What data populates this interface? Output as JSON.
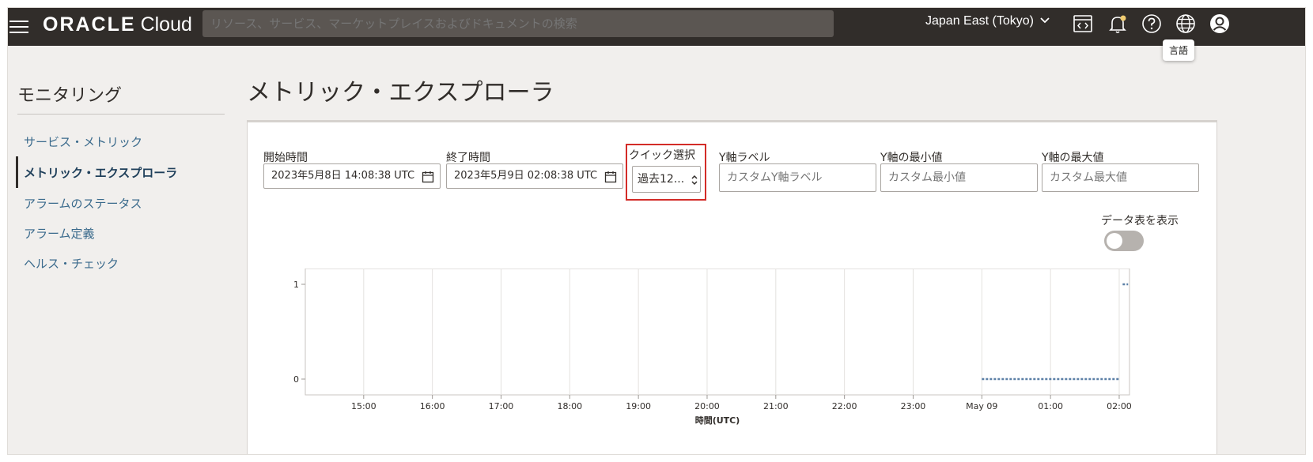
{
  "header": {
    "brand_oracle": "ORACLE",
    "brand_cloud": "Cloud",
    "search_placeholder": "リソース、サービス、マーケットプレイスおよびドキュメントの検索",
    "region": "Japan East (Tokyo)",
    "tooltip": "言語",
    "icons": [
      "hamburger-icon",
      "code-editor-icon",
      "bell-icon",
      "help-icon",
      "globe-icon",
      "profile-icon"
    ],
    "notification_dot_color": "#f0cc71"
  },
  "sidebar": {
    "title": "モニタリング",
    "items": [
      {
        "label": "サービス・メトリック"
      },
      {
        "label": "メトリック・エクスプローラ"
      },
      {
        "label": "アラームのステータス"
      },
      {
        "label": "アラーム定義"
      },
      {
        "label": "ヘルス・チェック"
      }
    ]
  },
  "main": {
    "title": "メトリック・エクスプローラ",
    "start_label": "開始時間",
    "start_value": "2023年5月8日 14:08:38 UTC",
    "end_label": "終了時間",
    "end_value": "2023年5月9日 02:08:38 UTC",
    "quick_label": "クイック選択",
    "quick_value": "過去12...",
    "ylabel_label": "Y軸ラベル",
    "ylabel_placeholder": "カスタムY軸ラベル",
    "ymin_label": "Y軸の最小値",
    "ymin_placeholder": "カスタム最小値",
    "ymax_label": "Y軸の最大値",
    "ymax_placeholder": "カスタム最大値",
    "table_toggle_label": "データ表を表示",
    "table_toggle_on": false
  },
  "chart_data": {
    "type": "line",
    "xlabel": "時間(UTC)",
    "ylabel": "",
    "x_ticks": [
      "15:00",
      "16:00",
      "17:00",
      "18:00",
      "19:00",
      "20:00",
      "21:00",
      "22:00",
      "23:00",
      "May 09",
      "01:00",
      "02:00"
    ],
    "y_ticks": [
      "0",
      "1"
    ],
    "ylim": [
      0,
      1
    ],
    "xlim_hours": [
      14.15,
      26.15
    ],
    "series": [
      {
        "color": "#5b7fa6",
        "points": [
          {
            "t": 24.0,
            "v": 0
          },
          {
            "t": 26.0,
            "v": 0
          },
          {
            "t": 26.05,
            "v": 1
          },
          {
            "t": 26.13,
            "v": 1
          }
        ]
      }
    ],
    "grid": true
  }
}
